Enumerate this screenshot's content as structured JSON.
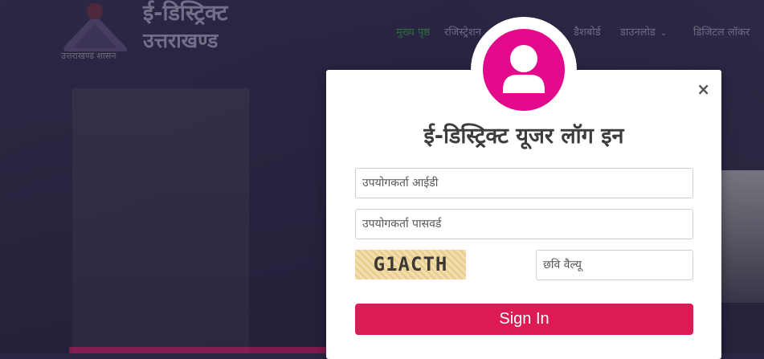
{
  "header": {
    "brand_title": "ई-डिस्ट्रिक्ट",
    "brand_subtitle": "उत्तराखण्ड",
    "emblem_caption": "उत्तराखण्ड शासन"
  },
  "nav": {
    "items": [
      {
        "label": "मुख्य पृष्ठ",
        "active": true
      },
      {
        "label": "रजिस्ट्रेशन"
      },
      {
        "label": "डैशबोर्ड"
      },
      {
        "label": "डाउनलोड"
      },
      {
        "label": "डिजिटल लॉकर"
      }
    ],
    "dropdown_icon": "chevron-down-icon"
  },
  "login": {
    "title": "ई-डिस्ट्रिक्ट यूजर लॉग इन",
    "close_label": "×",
    "username_placeholder": "उपयोगकर्ता आईडी",
    "password_placeholder": "उपयोगकर्ता पासवर्ड",
    "captcha_text": "G1ACTH",
    "captcha_placeholder": "छवि वैल्यू",
    "signin_label": "Sign In",
    "avatar_icon": "user-icon"
  },
  "colors": {
    "accent": "#dc1b54",
    "avatar": "#e3098d",
    "nav_active": "#2e6b3f"
  }
}
